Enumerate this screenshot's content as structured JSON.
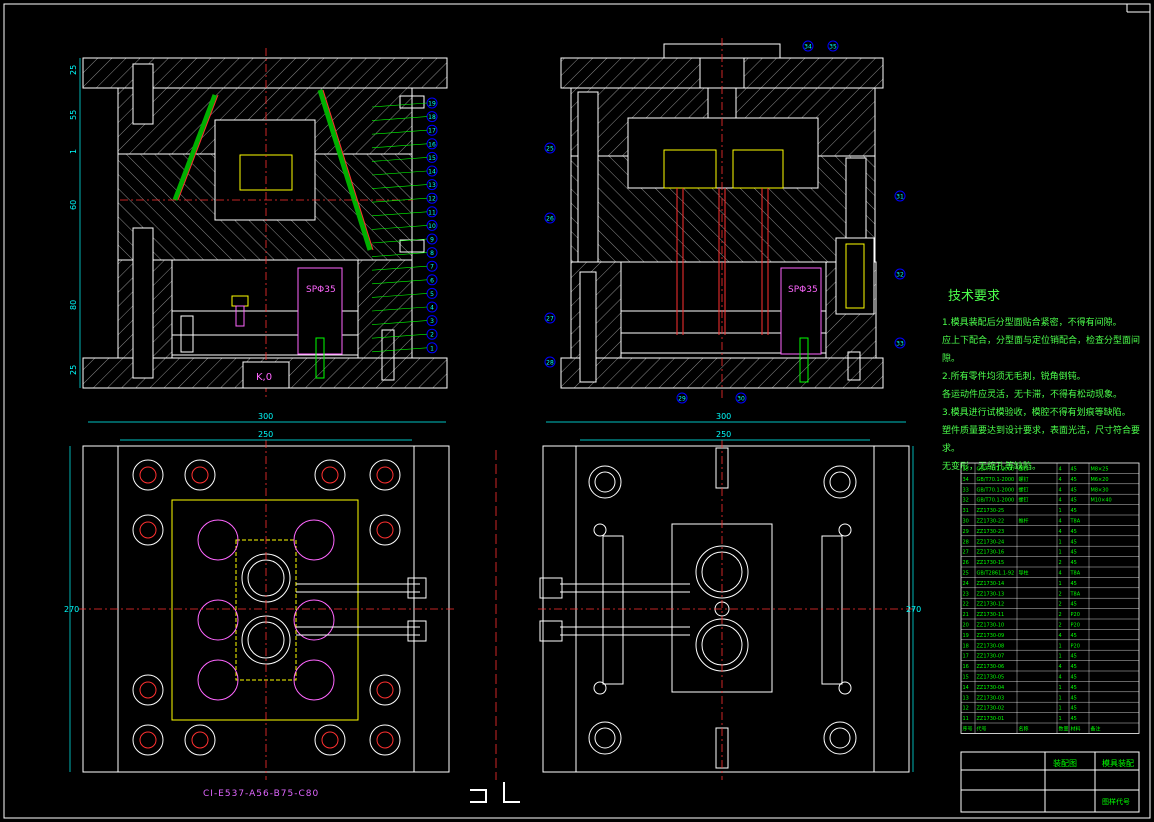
{
  "drawing": {
    "tech_title": "技术要求",
    "tech_notes": [
      "1.模具装配后分型面贴合紧密，不得有间隙。",
      "应上下配合，分型面与定位销配合，检查分型面间隙。",
      "2.所有零件均须无毛刺，锐角倒钝。",
      "各运动件应灵活，无卡滞，不得有松动现象。",
      "3.模具进行试模验收，模腔不得有划痕等缺陷。",
      "塑件质量要达到设计要求，表面光洁，尺寸符合要求。",
      "无变形，无缩孔等缺陷。"
    ],
    "part_code": "CI-E537-A56-B75-C80",
    "section_label_left": "K,0",
    "spring_label": "SPΦ35",
    "dims": {
      "top_left": [
        "25",
        "55",
        "1",
        "60",
        "80",
        "25"
      ],
      "width_outer": "300",
      "width_inner": "250",
      "height_plate": "270"
    },
    "callouts_front": [
      "19",
      "18",
      "17",
      "16",
      "15",
      "14",
      "13",
      "12",
      "11",
      "10",
      "9",
      "8",
      "7",
      "6",
      "5",
      "4",
      "3",
      "2",
      "1"
    ],
    "callouts_side": [
      "25",
      "26",
      "27",
      "28",
      "29",
      "30",
      "31",
      "32",
      "33",
      "34",
      "35"
    ],
    "bom_rows": [
      {
        "no": "35",
        "code": "GB/T70.1-2000",
        "name": "螺钉",
        "qty": "4",
        "mat": "45",
        "note": "M8×25"
      },
      {
        "no": "34",
        "code": "GB/T70.1-2000",
        "name": "螺钉",
        "qty": "4",
        "mat": "45",
        "note": "M6×20"
      },
      {
        "no": "33",
        "code": "GB/T70.1-2000",
        "name": "螺钉",
        "qty": "4",
        "mat": "45",
        "note": "M8×30"
      },
      {
        "no": "32",
        "code": "GB/T70.1-2000",
        "name": "螺钉",
        "qty": "4",
        "mat": "45",
        "note": "M10×40"
      },
      {
        "no": "31",
        "code": "ZZ1730-25",
        "name": "",
        "qty": "1",
        "mat": "45",
        "note": ""
      },
      {
        "no": "30",
        "code": "ZZ1730-22",
        "name": "推杆",
        "qty": "4",
        "mat": "T8A",
        "note": ""
      },
      {
        "no": "29",
        "code": "ZZ1730-23",
        "name": "",
        "qty": "4",
        "mat": "45",
        "note": ""
      },
      {
        "no": "28",
        "code": "ZZ1730-24",
        "name": "",
        "qty": "1",
        "mat": "45",
        "note": ""
      },
      {
        "no": "27",
        "code": "ZZ1730-16",
        "name": "",
        "qty": "1",
        "mat": "45",
        "note": ""
      },
      {
        "no": "26",
        "code": "ZZ1730-15",
        "name": "",
        "qty": "2",
        "mat": "45",
        "note": ""
      },
      {
        "no": "25",
        "code": "GB/T2861.1-92",
        "name": "导柱",
        "qty": "4",
        "mat": "T8A",
        "note": ""
      },
      {
        "no": "24",
        "code": "ZZ1730-14",
        "name": "",
        "qty": "1",
        "mat": "45",
        "note": ""
      },
      {
        "no": "23",
        "code": "ZZ1730-13",
        "name": "",
        "qty": "2",
        "mat": "T8A",
        "note": ""
      },
      {
        "no": "22",
        "code": "ZZ1730-12",
        "name": "",
        "qty": "2",
        "mat": "45",
        "note": ""
      },
      {
        "no": "21",
        "code": "ZZ1730-11",
        "name": "",
        "qty": "2",
        "mat": "P20",
        "note": ""
      },
      {
        "no": "20",
        "code": "ZZ1730-10",
        "name": "",
        "qty": "2",
        "mat": "P20",
        "note": ""
      },
      {
        "no": "19",
        "code": "ZZ1730-09",
        "name": "",
        "qty": "4",
        "mat": "45",
        "note": ""
      },
      {
        "no": "18",
        "code": "ZZ1730-08",
        "name": "",
        "qty": "1",
        "mat": "P20",
        "note": ""
      },
      {
        "no": "17",
        "code": "ZZ1730-07",
        "name": "",
        "qty": "1",
        "mat": "45",
        "note": ""
      },
      {
        "no": "16",
        "code": "ZZ1730-06",
        "name": "",
        "qty": "4",
        "mat": "45",
        "note": ""
      },
      {
        "no": "15",
        "code": "ZZ1730-05",
        "name": "",
        "qty": "4",
        "mat": "45",
        "note": ""
      },
      {
        "no": "14",
        "code": "ZZ1730-04",
        "name": "",
        "qty": "1",
        "mat": "45",
        "note": ""
      },
      {
        "no": "13",
        "code": "ZZ1730-03",
        "name": "",
        "qty": "1",
        "mat": "45",
        "note": ""
      },
      {
        "no": "12",
        "code": "ZZ1730-02",
        "name": "",
        "qty": "1",
        "mat": "45",
        "note": ""
      },
      {
        "no": "11",
        "code": "ZZ1730-01",
        "name": "",
        "qty": "1",
        "mat": "45",
        "note": ""
      }
    ],
    "bom_header": [
      "序号",
      "代号",
      "名称",
      "数量",
      "材料",
      "备注"
    ],
    "title_block": {
      "name": "装配图",
      "drawing_no": "模具装配",
      "sheet": "图样代号"
    }
  }
}
